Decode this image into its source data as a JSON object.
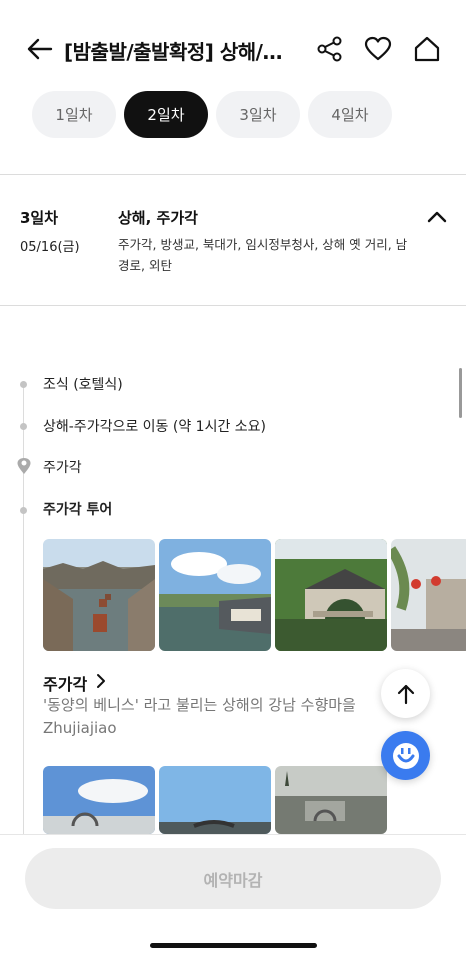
{
  "header": {
    "title": "[밤출발/출발확정] 상해/…",
    "icons": [
      "back-arrow-icon",
      "share-icon",
      "heart-icon",
      "home-icon"
    ]
  },
  "tabs": [
    {
      "label": "1일차",
      "active": false
    },
    {
      "label": "2일차",
      "active": true
    },
    {
      "label": "3일차",
      "active": false
    },
    {
      "label": "4일차",
      "active": false
    }
  ],
  "day": {
    "label": "3일차",
    "date": "05/16(금)",
    "title": "상해, 주가각",
    "desc": "주가각, 방생교, 북대가, 임시정부청사, 상해 옛 거리, 남경로, 외탄"
  },
  "timeline": [
    {
      "text": "조식 (호텔식)",
      "type": "dot"
    },
    {
      "text": "상해-주가각으로 이동 (약 1시간 소요)",
      "type": "dot"
    },
    {
      "text": "주가각",
      "type": "pin"
    },
    {
      "text": "주가각 투어",
      "type": "dot"
    }
  ],
  "place": {
    "title": "주가각",
    "subtitle": "'동양의 베니스' 라고 불리는 상해의 강남 수향마을 Zhujiajiao"
  },
  "bottom": {
    "reserve_label": "예약마감"
  },
  "colors": {
    "accent": "#3a7bef",
    "active_tab": "#111111"
  }
}
